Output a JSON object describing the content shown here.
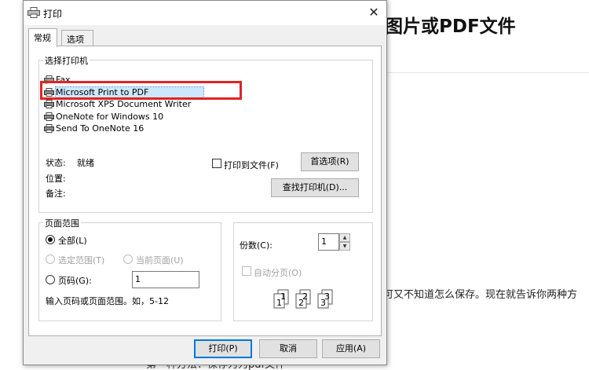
{
  "background": {
    "heading": "图片或PDF文件",
    "body_text": "可又不知道怎么保存。现在就告诉你两种方",
    "bottom_text": "第一种方法：保存为为pdf文件"
  },
  "dialog": {
    "title": "打印",
    "close_glyph": "✕",
    "tabs": [
      {
        "label": "常规",
        "active": true
      },
      {
        "label": "选项",
        "active": false
      }
    ],
    "select_printer": {
      "legend": "选择打印机",
      "printers": [
        {
          "name": "Fax",
          "icon": "fax-icon"
        },
        {
          "name": "Microsoft Print to PDF",
          "icon": "printer-icon",
          "selected": true
        },
        {
          "name": "Microsoft XPS Document Writer",
          "icon": "printer-icon"
        },
        {
          "name": "OneNote for Windows 10",
          "icon": "printer-icon"
        },
        {
          "name": "Send To OneNote 16",
          "icon": "printer-icon"
        }
      ],
      "status_label": "状态:",
      "status_value": "就绪",
      "location_label": "位置:",
      "comment_label": "备注:",
      "print_to_file": "打印到文件(F)",
      "preferences_button": "首选项(R)",
      "find_printer_button": "查找打印机(D)..."
    },
    "page_range": {
      "legend": "页面范围",
      "all": "全部(L)",
      "selection": "选定范围(T)",
      "current_page": "当前页面(U)",
      "pages": "页码(G):",
      "pages_value": "1",
      "hint": "输入页码或页面范围。如，5-12"
    },
    "copies": {
      "label": "份数(C):",
      "value": "1",
      "collate": "自动分页(O)",
      "up_glyph": "▲",
      "down_glyph": "▼",
      "collate_pages": [
        "1",
        "1",
        "2",
        "2",
        "3",
        "3"
      ]
    },
    "buttons": {
      "print": "打印(P)",
      "cancel": "取消",
      "apply": "应用(A)"
    }
  }
}
